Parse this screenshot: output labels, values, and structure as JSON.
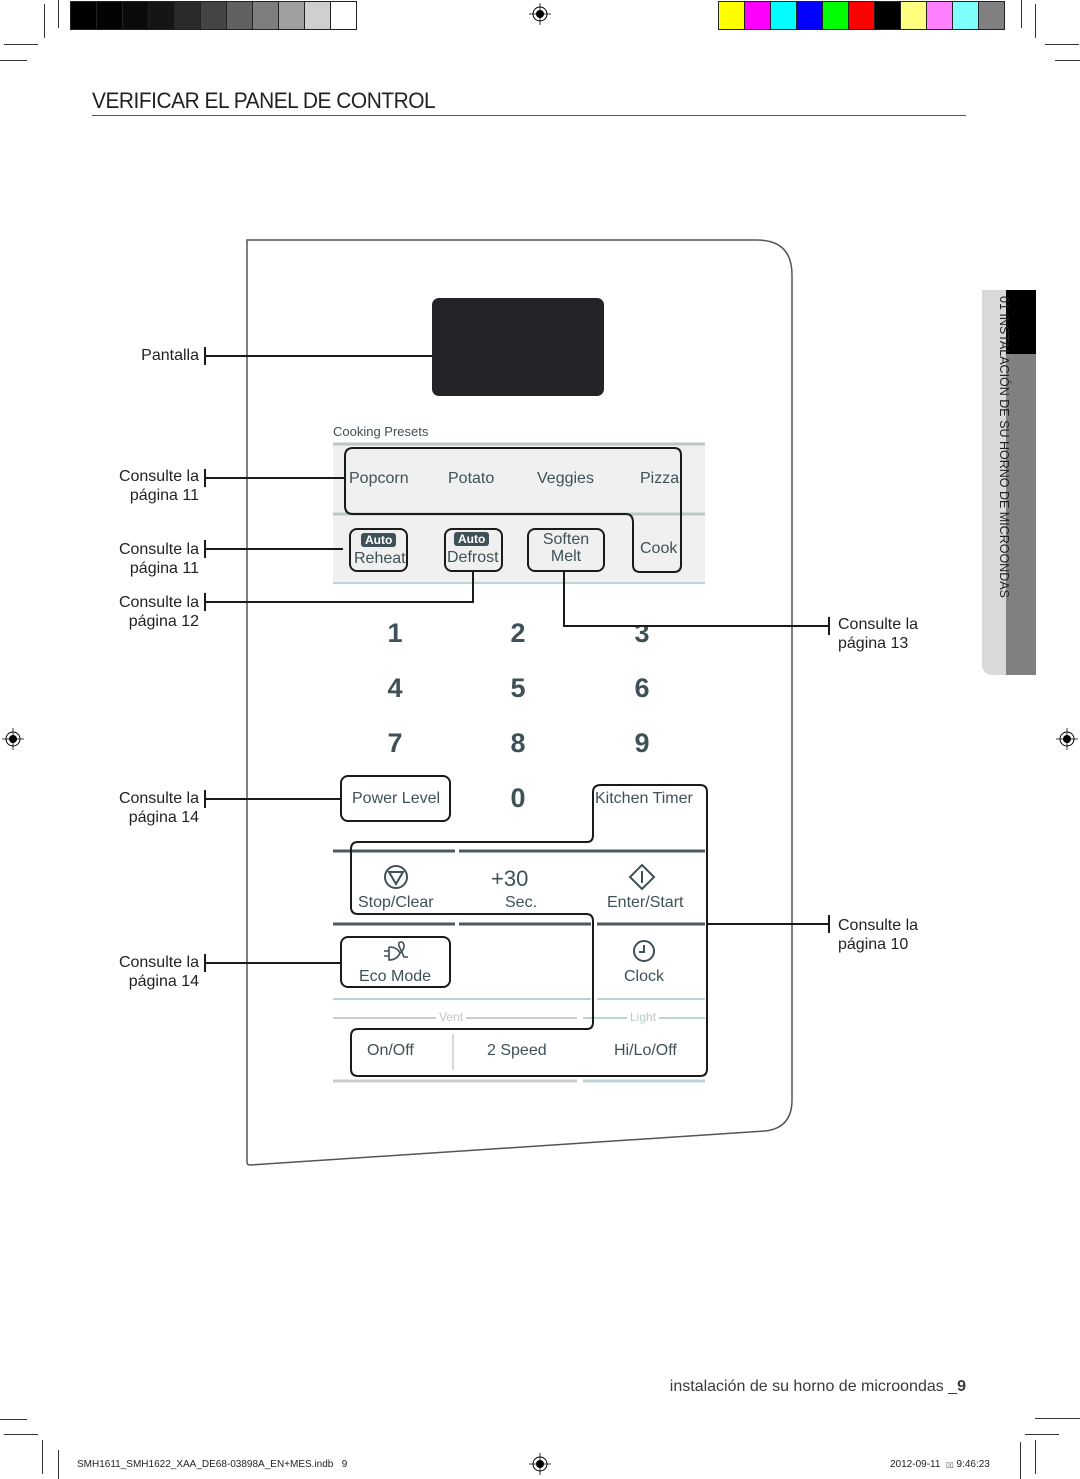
{
  "print_marks": {
    "grayscale_swatches": [
      "#000000",
      "#030303",
      "#0b0b0b",
      "#151515",
      "#2a2a2a",
      "#444444",
      "#616161",
      "#7e7e7e",
      "#a0a0a0",
      "#cfcfcf",
      "#ffffff"
    ],
    "color_swatches": [
      "#ffff00",
      "#ff00ff",
      "#00ffff",
      "#0000ff",
      "#00ff00",
      "#ff0000",
      "#000000",
      "#ffff80",
      "#ff80ff",
      "#80ffff",
      "#808080"
    ],
    "registration_icon": "registration-crosshair-icon"
  },
  "page": {
    "title": "VERIFICAR EL PANEL DE CONTROL",
    "side_tab": "01 INSTALACIÓN DE SU HORNO DE MICROONDAS",
    "footer_section": "instalación de su horno de microondas _",
    "footer_page": "9",
    "slug_file": "SMH1611_SMH1622_XAA_DE68-03898A_EN+MES.indb   9",
    "slug_date": "2012-09-11",
    "slug_time": "9:46:23",
    "slug_glyph": "▯▯"
  },
  "callouts": {
    "display": "Pantalla",
    "presets": {
      "line1": "Consulte la",
      "line2": "página 11"
    },
    "auto": {
      "line1": "Consulte la",
      "line2": "página 11"
    },
    "defrost": {
      "line1": "Consulte la",
      "line2": "página 12"
    },
    "soften": {
      "line1": "Consulte la",
      "line2": "página 13"
    },
    "power": {
      "line1": "Consulte la",
      "line2": "página 14"
    },
    "eco": {
      "line1": "Consulte la",
      "line2": "página 14"
    },
    "clock": {
      "line1": "Consulte la",
      "line2": "página 10"
    }
  },
  "panel": {
    "presets_label": "Cooking Presets",
    "presets": [
      "Popcorn",
      "Potato",
      "Veggies",
      "Pizza"
    ],
    "auto_badge": "Auto",
    "reheat": "Reheat",
    "defrost": "Defrost",
    "soften_line1": "Soften",
    "soften_line2": "Melt",
    "cook": "Cook",
    "keypad": [
      "1",
      "2",
      "3",
      "4",
      "5",
      "6",
      "7",
      "8",
      "9",
      "0"
    ],
    "power_level": "Power Level",
    "kitchen_timer": "Kitchen Timer",
    "stop_clear": "Stop/Clear",
    "plus30": "+30",
    "sec": "Sec.",
    "enter_start": "Enter/Start",
    "eco_mode": "Eco Mode",
    "clock": "Clock",
    "vent_label": "Vent",
    "light_label": "Light",
    "on_off": "On/Off",
    "two_speed": "2 Speed",
    "hi_lo_off": "Hi/Lo/Off",
    "colors": {
      "text": "#3e5157",
      "display": "#232427",
      "divider_dark": "#4a5a5d",
      "divider_light": "#bcd3d3"
    }
  }
}
